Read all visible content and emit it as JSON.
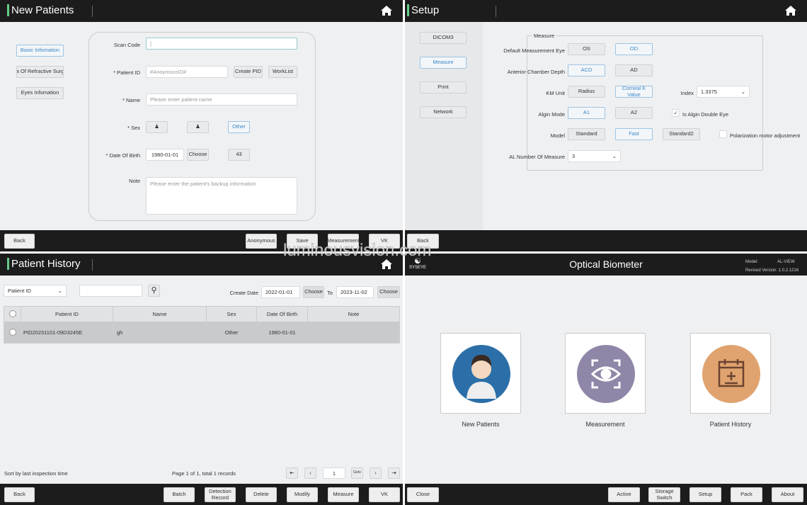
{
  "watermark": "luminousvision.com",
  "new_patients": {
    "title": "New Patients",
    "tabs": [
      "Basic Infomation",
      "ta Of Refractive Surgi",
      "Eyes Infomation"
    ],
    "scan_code_label": "Scan Code",
    "patient_id_label": "* Patient ID",
    "patient_id_placeholder": "#AnoymousID#",
    "create_pid": "Create PID",
    "worklist": "WorkList",
    "name_label": "* Name",
    "name_placeholder": "Please enter patient name",
    "sex_label": "* Sex",
    "sex_other": "Other",
    "dob_label": "* Date Of Birth",
    "dob_value": "1980-01-01",
    "choose": "Choose",
    "age": "43",
    "note_label": "Note",
    "note_placeholder": "Please enter the patient's backup information",
    "footer": {
      "back": "Back",
      "anonymous": "Anonymous",
      "save": "Save",
      "measurement": "Measurement",
      "vk": "VK"
    }
  },
  "setup": {
    "title": "Setup",
    "nav": [
      "DICOM3",
      "Measure",
      "Print",
      "Network"
    ],
    "group": "Measure",
    "default_eye_label": "Default Measurement Eye",
    "os": "OS",
    "od": "OD",
    "acd_label": "Anterior Chamber Depth",
    "acd": "ACD",
    "ad": "AD",
    "km_label": "KM Unit",
    "radius": "Radius",
    "corneal": "Corneal K Value",
    "index_label": "Index",
    "index_value": "1.3375",
    "align_label": "Algin Mode",
    "a1": "A1",
    "a2": "A2",
    "double_eye": "Is Algin Double Eye",
    "double_eye_checked": true,
    "model_label": "Model",
    "standard": "Standard",
    "fast": "Fast",
    "standard2": "Standard2",
    "polarization": "Polarization motor adjustment",
    "polarization_checked": false,
    "al_label": "AL Number Of Measure",
    "al_value": "3",
    "footer": {
      "back": "Back"
    }
  },
  "history": {
    "title": "Patient History",
    "filter": "Patient ID",
    "create_date_label": "Create Date",
    "from": "2022-01-01",
    "choose": "Choose",
    "to_label": "To",
    "to": "2023-11-02",
    "columns": [
      "Patient ID",
      "Name",
      "Sex",
      "Date Of Birth",
      "Note"
    ],
    "rows": [
      {
        "id": "PID20231101-09D3245E",
        "name": "gh",
        "sex": "Other",
        "dob": "1980-01-01",
        "note": ""
      }
    ],
    "sort_text": "Sort by last inspection time",
    "page_info": "Page 1 of 1, total 1 records",
    "page": "1",
    "goto": "Goto",
    "footer": {
      "back": "Back",
      "batch": "Batch",
      "detection": "Detection Record",
      "delete": "Delete",
      "modify": "Modify",
      "measure": "Measure",
      "vk": "VK"
    }
  },
  "home": {
    "logo": "SYSEYE",
    "title": "Optical Biometer",
    "model_label": "Model:",
    "model": "AL-VIEW",
    "version_label": "Revised Version:",
    "version": "1.0.2.1216",
    "tiles": [
      "New Patients",
      "Measurement",
      "Patient History"
    ],
    "footer": {
      "close": "Close",
      "active": "Active",
      "storage": "Storage Switch",
      "setup": "Setup",
      "pack": "Pack",
      "about": "About"
    }
  }
}
